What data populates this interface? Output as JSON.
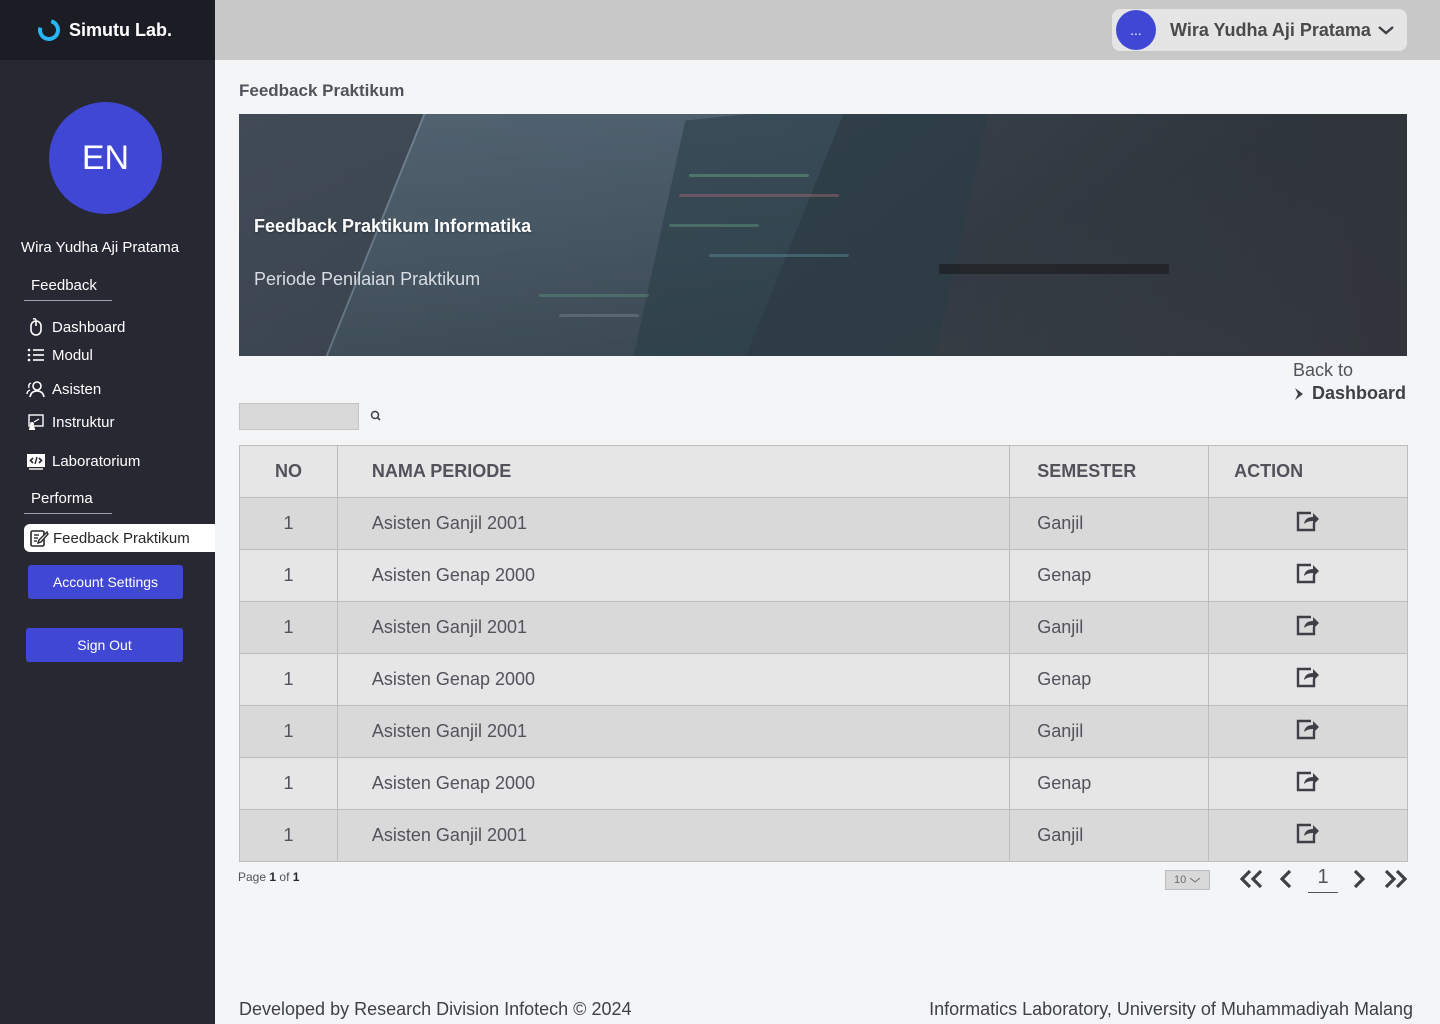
{
  "brand": {
    "name": "Simutu Lab."
  },
  "sidebar": {
    "avatar_initials": "EN",
    "username": "Wira Yudha Aji Pratama",
    "section_feedback": "Feedback",
    "items": [
      {
        "label": "Dashboard",
        "icon": "mouse-icon"
      },
      {
        "label": "Modul",
        "icon": "list-icon"
      },
      {
        "label": "Asisten",
        "icon": "users-icon"
      },
      {
        "label": "Instruktur",
        "icon": "teacher-icon"
      },
      {
        "label": "Laboratorium",
        "icon": "code-icon"
      }
    ],
    "section_performa": "Performa",
    "active_item": {
      "label": "Feedback Praktikum",
      "icon": "edit-note-icon"
    },
    "account_settings": "Account Settings",
    "sign_out": "Sign Out"
  },
  "topbar": {
    "avatar_text": "...",
    "user_name": "Wira Yudha Aji Pratama"
  },
  "page_title": "Feedback Praktikum",
  "banner": {
    "title": "Feedback Praktikum Informatika",
    "subtitle": "Periode Penilaian Praktikum"
  },
  "back": {
    "label": "Back to",
    "link": "Dashboard"
  },
  "table": {
    "headers": {
      "no": "NO",
      "name": "NAMA PERIODE",
      "semester": "SEMESTER",
      "action": "ACTION"
    },
    "rows": [
      {
        "no": "1",
        "name": "Asisten Ganjil 2001",
        "semester": "Ganjil"
      },
      {
        "no": "1",
        "name": "Asisten Genap 2000",
        "semester": "Genap"
      },
      {
        "no": "1",
        "name": "Asisten Ganjil 2001",
        "semester": "Ganjil"
      },
      {
        "no": "1",
        "name": "Asisten Genap 2000",
        "semester": "Genap"
      },
      {
        "no": "1",
        "name": "Asisten Ganjil 2001",
        "semester": "Ganjil"
      },
      {
        "no": "1",
        "name": "Asisten Genap 2000",
        "semester": "Genap"
      },
      {
        "no": "1",
        "name": "Asisten Ganjil 2001",
        "semester": "Ganjil"
      }
    ]
  },
  "pagination": {
    "page_word": "Page",
    "current": "1",
    "of_word": "of",
    "total": "1",
    "per_page": "10",
    "page_number": "1"
  },
  "footer": {
    "left": "Developed by Research Division Infotech © 2024",
    "right": "Informatics Laboratory, University of Muhammadiyah Malang"
  },
  "colors": {
    "accent": "#4147d5",
    "sidebar_bg": "#282833",
    "brand_bg": "#1c1c24",
    "topbar_bg": "#c8c8c8"
  }
}
